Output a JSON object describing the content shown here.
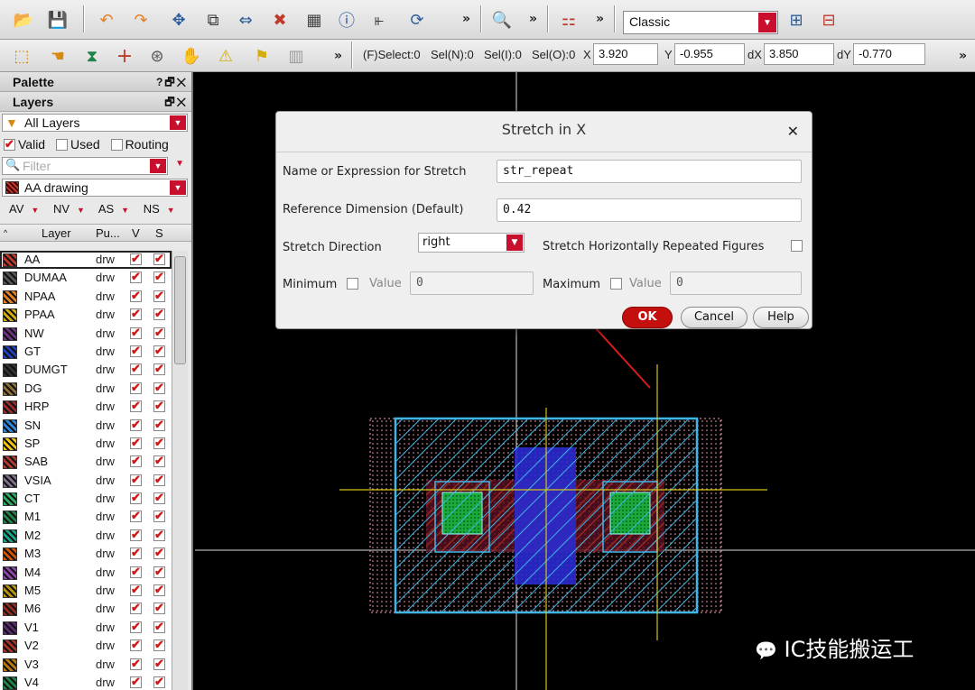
{
  "toolbar1": {
    "more1": "»",
    "more2": "»",
    "more3": "»",
    "workspace_value": "Classic"
  },
  "toolbar2": {
    "more1": "»",
    "more2": "»",
    "fselect": "(F)Select:0",
    "sel_n": "Sel(N):0",
    "sel_i": "Sel(I):0",
    "sel_o": "Sel(O):0",
    "x_label": "X",
    "x_value": "3.920",
    "y_label": "Y",
    "y_value": "-0.955",
    "dx_label": "dX",
    "dx_value": "3.850",
    "dy_label": "dY",
    "dy_value": "-0.770"
  },
  "palette": {
    "title": "Palette",
    "title_buttons": "?🗗✕",
    "layers_title": "Layers",
    "layers_buttons": "🗗✕",
    "filter_value": "All Layers",
    "valid_label": "Valid",
    "used_label": "Used",
    "routing_label": "Routing",
    "search_placeholder": "Filter",
    "current_layer": "AA drawing",
    "vis_av": "AV",
    "vis_nv": "NV",
    "vis_as": "AS",
    "vis_ns": "NS",
    "col_layer": "Layer",
    "col_purpose": "Pu...",
    "col_v": "V",
    "col_s": "S"
  },
  "layers": [
    {
      "name": "AA",
      "purpose": "drw",
      "color": "#c0392b"
    },
    {
      "name": "DUMAA",
      "purpose": "drw",
      "color": "#555555"
    },
    {
      "name": "NPAA",
      "purpose": "drw",
      "color": "#e67e22"
    },
    {
      "name": "PPAA",
      "purpose": "drw",
      "color": "#d4ac0d"
    },
    {
      "name": "NW",
      "purpose": "drw",
      "color": "#6c3483"
    },
    {
      "name": "GT",
      "purpose": "drw",
      "color": "#1f3fbf"
    },
    {
      "name": "DUMGT",
      "purpose": "drw",
      "color": "#333333"
    },
    {
      "name": "DG",
      "purpose": "drw",
      "color": "#8e6e3a"
    },
    {
      "name": "HRP",
      "purpose": "drw",
      "color": "#9a2b2b"
    },
    {
      "name": "SN",
      "purpose": "drw",
      "color": "#2e86de"
    },
    {
      "name": "SP",
      "purpose": "drw",
      "color": "#f1c40f"
    },
    {
      "name": "SAB",
      "purpose": "drw",
      "color": "#b03a2e"
    },
    {
      "name": "VSIA",
      "purpose": "drw",
      "color": "#7d6e8a"
    },
    {
      "name": "CT",
      "purpose": "drw",
      "color": "#27ae60"
    },
    {
      "name": "M1",
      "purpose": "drw",
      "color": "#1e8449"
    },
    {
      "name": "M2",
      "purpose": "drw",
      "color": "#17a589"
    },
    {
      "name": "M3",
      "purpose": "drw",
      "color": "#d35400"
    },
    {
      "name": "M4",
      "purpose": "drw",
      "color": "#8e44ad"
    },
    {
      "name": "M5",
      "purpose": "drw",
      "color": "#b7950b"
    },
    {
      "name": "M6",
      "purpose": "drw",
      "color": "#922b21"
    },
    {
      "name": "V1",
      "purpose": "drw",
      "color": "#5b2c6f"
    },
    {
      "name": "V2",
      "purpose": "drw",
      "color": "#a93226"
    },
    {
      "name": "V3",
      "purpose": "drw",
      "color": "#b9770e"
    },
    {
      "name": "V4",
      "purpose": "drw",
      "color": "#1d8348"
    }
  ],
  "dialog": {
    "title": "Stretch in X",
    "close": "✕",
    "name_label": "Name or Expression for Stretch",
    "name_value": "str_repeat",
    "ref_label": "Reference Dimension (Default)",
    "ref_value": "0.42",
    "dir_label": "Stretch Direction",
    "dir_value": "right",
    "repeated_label": "Stretch Horizontally Repeated Figures",
    "min_label": "Minimum",
    "min_value_label": "Value",
    "min_value": "0",
    "max_label": "Maximum",
    "max_value_label": "Value",
    "max_value": "0",
    "ok": "OK",
    "cancel": "Cancel",
    "help": "Help"
  },
  "watermark": "IC技能搬运工"
}
